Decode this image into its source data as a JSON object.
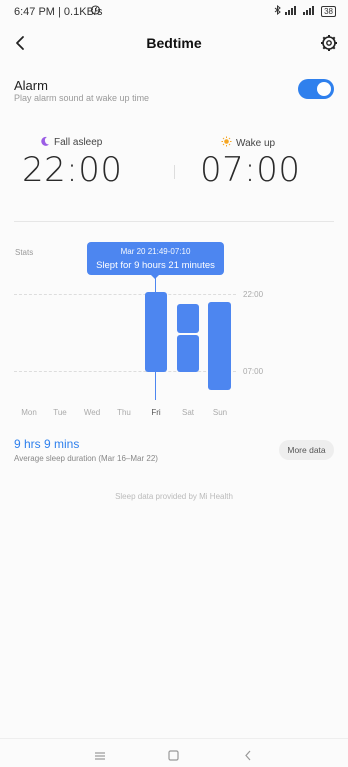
{
  "status_bar": {
    "time_speed": "6:47 PM | 0.1KB/s",
    "battery": "38"
  },
  "header": {
    "title": "Bedtime"
  },
  "alarm": {
    "label": "Alarm",
    "sublabel": "Play alarm sound at wake up time",
    "enabled": true
  },
  "fall_asleep": {
    "label": "Fall asleep",
    "time": "22:00"
  },
  "wake_up": {
    "label": "Wake up",
    "time": "07:00"
  },
  "stats": {
    "label": "Stats",
    "y_labels": [
      "22:00",
      "07:00"
    ],
    "days": [
      "Mon",
      "Tue",
      "Wed",
      "Thu",
      "Fri",
      "Sat",
      "Sun"
    ],
    "selected_day": "Fri",
    "tooltip": {
      "range": "Mar 20 21:49-07:10",
      "summary": "Slept for 9 hours 21 minutes"
    }
  },
  "summary": {
    "average": "9 hrs 9 mins",
    "average_caption": "Average sleep duration (Mar 16–Mar 22)",
    "more_button": "More data"
  },
  "footer_note": "Sleep data provided by Mi Health",
  "colors": {
    "accent": "#2f80ed",
    "bar": "#4d86f0"
  }
}
